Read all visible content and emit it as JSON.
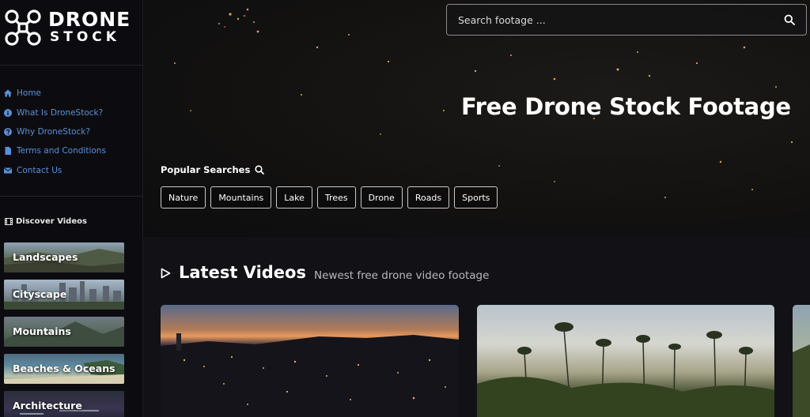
{
  "logo": {
    "line1": "DRONE",
    "line2": "STOCK"
  },
  "nav": [
    {
      "label": "Home",
      "icon": "home-icon"
    },
    {
      "label": "What Is DroneStock?",
      "icon": "info-icon"
    },
    {
      "label": "Why DroneStock?",
      "icon": "question-icon"
    },
    {
      "label": "Terms and Conditions",
      "icon": "document-icon"
    },
    {
      "label": "Contact Us",
      "icon": "envelope-icon"
    }
  ],
  "discover": {
    "label": "Discover Videos",
    "icon": "film-icon"
  },
  "categories": [
    {
      "label": "Landscapes"
    },
    {
      "label": "Cityscape"
    },
    {
      "label": "Mountains"
    },
    {
      "label": "Beaches & Oceans"
    },
    {
      "label": "Architecture"
    }
  ],
  "search": {
    "placeholder": "Search footage ...",
    "icon": "search-icon"
  },
  "hero": {
    "title": "Free Drone Stock Footage"
  },
  "popular": {
    "label": "Popular Searches",
    "tags": [
      "Nature",
      "Mountains",
      "Lake",
      "Trees",
      "Drone",
      "Roads",
      "Sports"
    ]
  },
  "latest": {
    "title": "Latest Videos",
    "subtitle": "Newest free drone video footage",
    "icon": "play-outline-icon"
  },
  "colors": {
    "accent_link": "#5b8fd9",
    "background": "#111116",
    "sidebar": "#0c0c10"
  }
}
